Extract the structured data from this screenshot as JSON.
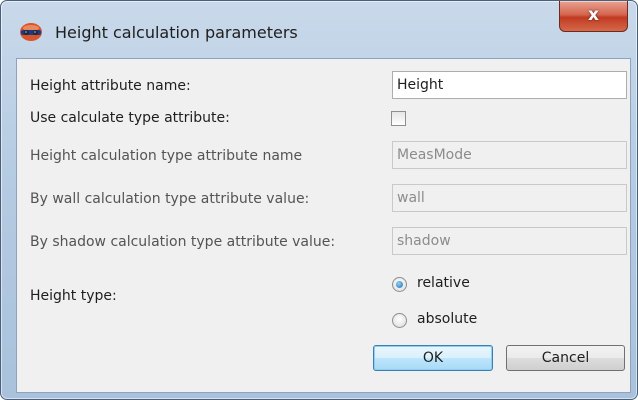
{
  "window": {
    "title": "Height calculation parameters",
    "close_label": "x"
  },
  "form": {
    "height_attr_label": "Height attribute name:",
    "height_attr_value": "Height",
    "use_calc_type_label": "Use calculate type attribute:",
    "use_calc_type_checked": false,
    "calc_type_attr_label": "Height calculation type attribute name",
    "calc_type_attr_value": "MeasMode",
    "by_wall_label": "By wall calculation type attribute value:",
    "by_wall_value": "wall",
    "by_shadow_label": "By shadow calculation type attribute value:",
    "by_shadow_value": "shadow",
    "height_type_label": "Height type:",
    "height_type_options": [
      "relative",
      "absolute"
    ],
    "height_type_selected": "relative"
  },
  "buttons": {
    "ok": "OK",
    "cancel": "Cancel"
  }
}
